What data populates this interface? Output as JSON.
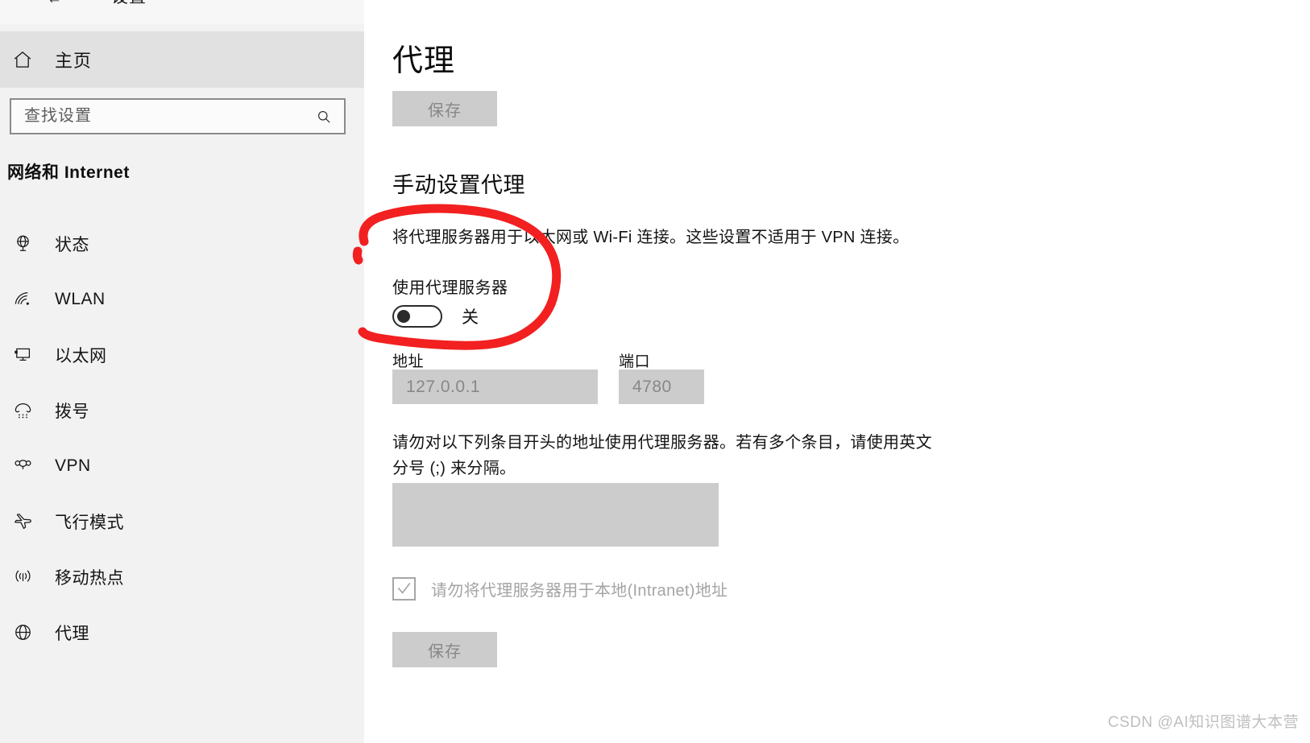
{
  "window": {
    "back_icon": "back-arrow-icon",
    "chrome_title": "设置"
  },
  "sidebar": {
    "home": {
      "label": "主页",
      "icon": "home-icon"
    },
    "search": {
      "placeholder": "查找设置",
      "value": "",
      "icon": "search-icon"
    },
    "section_title": "网络和 Internet",
    "items": [
      {
        "label": "状态",
        "icon": "globe-status-icon"
      },
      {
        "label": "WLAN",
        "icon": "wifi-icon"
      },
      {
        "label": "以太网",
        "icon": "ethernet-monitor-icon"
      },
      {
        "label": "拨号",
        "icon": "dialup-phone-icon"
      },
      {
        "label": "VPN",
        "icon": "vpn-icon"
      },
      {
        "label": "飞行模式",
        "icon": "airplane-icon"
      },
      {
        "label": "移动热点",
        "icon": "hotspot-broadcast-icon"
      },
      {
        "label": "代理",
        "icon": "globe-proxy-icon"
      }
    ]
  },
  "main": {
    "page_title": "代理",
    "save_top_label": "保存",
    "save_bottom_label": "保存",
    "manual_heading": "手动设置代理",
    "manual_description": "将代理服务器用于以太网或 Wi-Fi 连接。这些设置不适用于 VPN 连接。",
    "use_proxy_label": "使用代理服务器",
    "toggle_state_label": "关",
    "address_label": "地址",
    "address_value": "127.0.0.1",
    "port_label": "端口",
    "port_value": "4780",
    "exclusion_note": "请勿对以下列条目开头的地址使用代理服务器。若有多个条目，请使用英文分号 (;) 来分隔。",
    "exclusion_value": "",
    "local_bypass_label": "请勿将代理服务器用于本地(Intranet)地址"
  },
  "annotation": {
    "type": "hand-drawn-red-circle",
    "color": "#f22020"
  },
  "watermark": "CSDN @AI知识图谱大本营",
  "colors": {
    "sidebar_bg": "#f2f2f2",
    "home_row_bg": "#e1e1e1",
    "disabled_control_bg": "#cccccc",
    "disabled_text": "#888888",
    "annotation_red": "#f22020"
  }
}
